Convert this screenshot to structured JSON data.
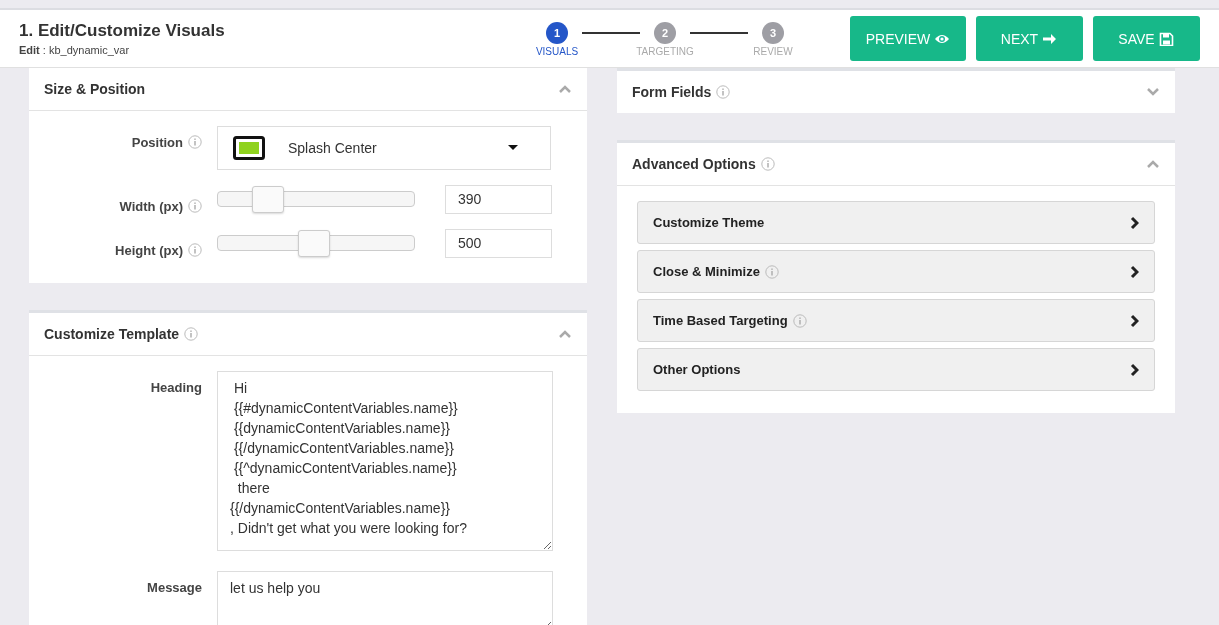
{
  "header": {
    "title": "1. Edit/Customize Visuals",
    "edit_line": "**Edit** : kb_dynamic_var"
  },
  "steps": [
    {
      "number": "1",
      "label": "VISUALS",
      "selected": true
    },
    {
      "number": "2",
      "label": "TARGETING",
      "selected": false
    },
    {
      "number": "3",
      "label": "REVIEW",
      "selected": false
    }
  ],
  "buttons": [
    {
      "label": "PREVIEW",
      "kind": "eye"
    },
    {
      "label": "NEXT",
      "kind": "arrow"
    },
    {
      "label": "SAVE",
      "kind": "save"
    }
  ],
  "size_position": {
    "title": "Size & Position",
    "expanded": true,
    "position": {
      "label": "Position",
      "value": "Splash Center"
    },
    "sliders": [
      {
        "label": "Width (px)",
        "level": 0.26,
        "value": "390"
      },
      {
        "label": "Height (px)",
        "level": 0.49,
        "value": "500"
      }
    ]
  },
  "customize_template": {
    "title": "Customize Template",
    "expanded": true,
    "fields": [
      {
        "label": "Heading",
        "value": " Hi\n {{#dynamicContentVariables.name}}\n {{dynamicContentVariables.name}}\n {{/dynamicContentVariables.name}}\n {{^dynamicContentVariables.name}}\n  there\n{{/dynamicContentVariables.name}}\n, Didn't get what you were looking for?"
      },
      {
        "label": "Message",
        "value": "let us help you"
      }
    ]
  },
  "form_fields": {
    "title": "Form Fields",
    "expanded": false
  },
  "advanced_options": {
    "title": "Advanced Options",
    "expanded": true,
    "items": [
      {
        "label": "Customize Theme",
        "info": false
      },
      {
        "label": "Close & Minimize",
        "info": true
      },
      {
        "label": "Time Based Targeting",
        "info": true
      },
      {
        "label": "Other Options",
        "info": false
      }
    ]
  }
}
